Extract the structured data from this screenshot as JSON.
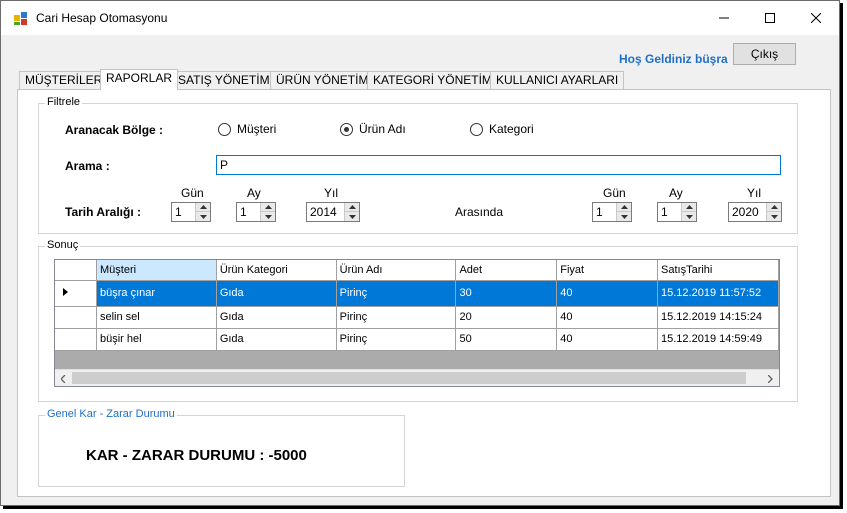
{
  "window": {
    "title": "Cari Hesap Otomasyonu"
  },
  "header": {
    "welcome": "Hoş Geldiniz büşra",
    "exit_label": "Çıkış"
  },
  "tabs": [
    {
      "label": "MÜŞTERİLER",
      "active": false
    },
    {
      "label": "RAPORLAR",
      "active": true
    },
    {
      "label": "SATIŞ YÖNETİMİ",
      "active": false
    },
    {
      "label": "ÜRÜN YÖNETİMİ",
      "active": false
    },
    {
      "label": "KATEGORİ YÖNETİMİ",
      "active": false
    },
    {
      "label": "KULLANICI AYARLARI",
      "active": false
    }
  ],
  "filter": {
    "legend": "Filtrele",
    "search_area_label": "Aranacak Bölge  :",
    "radios": [
      {
        "label": "Müşteri",
        "checked": false
      },
      {
        "label": "Ürün Adı",
        "checked": true
      },
      {
        "label": "Kategori",
        "checked": false
      }
    ],
    "search_label": "Arama  :",
    "search_value": "P",
    "date_range_label": "Tarih Aralığı  :",
    "between_label": "Arasında",
    "day_label": "Gün",
    "month_label": "Ay",
    "year_label": "Yıl",
    "start": {
      "day": "1",
      "month": "1",
      "year": "2014"
    },
    "end": {
      "day": "1",
      "month": "1",
      "year": "2020"
    }
  },
  "result": {
    "legend": "Sonuç",
    "columns": [
      "Müşteri",
      "Ürün Kategori",
      "Ürün Adı",
      "Adet",
      "Fiyat",
      "SatışTarihi"
    ],
    "rows": [
      [
        "büşra çınar",
        "Gıda",
        "Pirinç",
        "30",
        "40",
        "15.12.2019 11:57:52"
      ],
      [
        "selin sel",
        "Gıda",
        "Pirinç",
        "20",
        "40",
        "15.12.2019 14:15:24"
      ],
      [
        "büşir hel",
        "Gıda",
        "Pirinç",
        "50",
        "40",
        "15.12.2019 14:59:49"
      ]
    ],
    "selected_row": 0
  },
  "profit": {
    "legend": "Genel Kar - Zarar Durumu",
    "text": "KAR - ZARAR DURUMU : -5000"
  },
  "colors": {
    "accent": "#0078d7",
    "welcome": "#1f6fc6",
    "legend_blue": "#1f6fc6"
  }
}
